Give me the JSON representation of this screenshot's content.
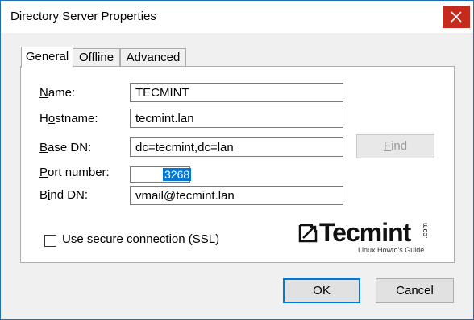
{
  "window": {
    "title": "Directory Server Properties"
  },
  "tabs": [
    {
      "label": "General",
      "active": true
    },
    {
      "label": "Offline",
      "active": false
    },
    {
      "label": "Advanced",
      "active": false
    }
  ],
  "form": {
    "name": {
      "label_pre": "",
      "label_u": "N",
      "label_post": "ame:",
      "value": "TECMINT"
    },
    "hostname": {
      "label_pre": "H",
      "label_u": "o",
      "label_post": "stname:",
      "value": "tecmint.lan"
    },
    "base_dn": {
      "label_pre": "",
      "label_u": "B",
      "label_post": "ase DN:",
      "value": "dc=tecmint,dc=lan"
    },
    "port": {
      "label_pre": "",
      "label_u": "P",
      "label_post": "ort number:",
      "value": "3268"
    },
    "bind_dn": {
      "label_pre": "B",
      "label_u": "i",
      "label_post": "nd DN:",
      "value": "vmail@tecmint.lan"
    }
  },
  "find_button": {
    "label_u": "F",
    "label_post": "ind"
  },
  "ssl": {
    "label_u": "U",
    "label_post": "se secure connection (SSL)",
    "checked": false
  },
  "logo": {
    "word": "Tecmint",
    "suffix": ".com",
    "tagline": "Linux Howto's Guide"
  },
  "buttons": {
    "ok": "OK",
    "cancel": "Cancel"
  },
  "colors": {
    "accent": "#0078d7",
    "close_bg": "#c42b1c"
  }
}
